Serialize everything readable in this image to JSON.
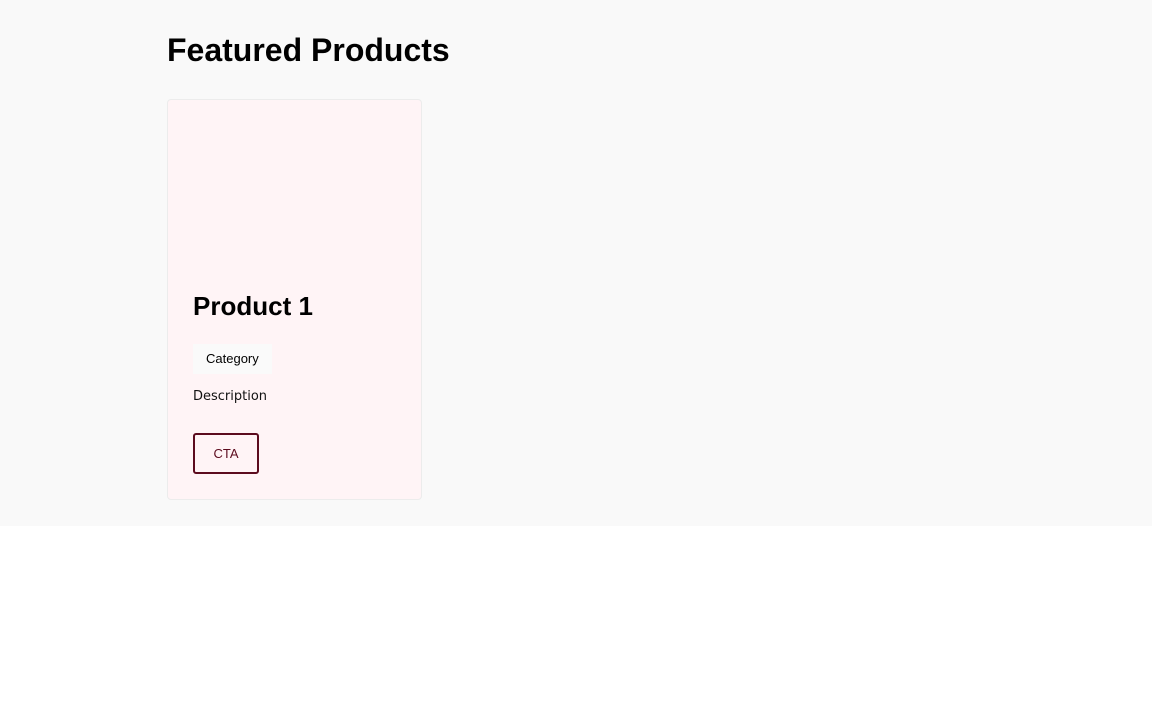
{
  "section": {
    "title": "Featured Products"
  },
  "products": [
    {
      "name": "Product 1",
      "category": "Category",
      "description": "Description",
      "cta_label": "CTA"
    }
  ],
  "colors": {
    "section_background": "#f9f9f9",
    "card_background": "#fff4f6",
    "cta_accent": "#5c0b1e"
  }
}
